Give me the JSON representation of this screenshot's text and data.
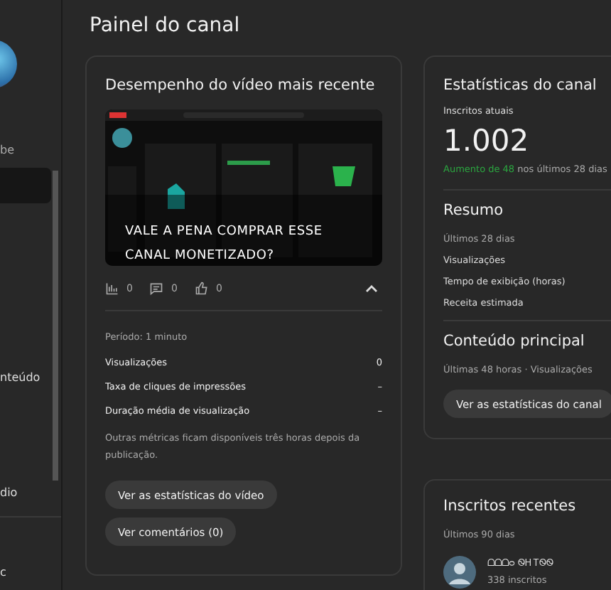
{
  "sidebar": {
    "items": [
      {
        "label": "be",
        "selected": false
      },
      {
        "selected": true
      },
      {
        "label": "nteúdo",
        "selected": false
      },
      {
        "label": "dio",
        "selected": false
      }
    ],
    "footer": "c"
  },
  "page_title": "Painel do canal",
  "video_card": {
    "title": "Desempenho do vídeo mais recente",
    "video_title": "VALE A PENA COMPRAR ESSE CANAL MONETIZADO?",
    "counts": [
      {
        "kind": "views",
        "value": "0"
      },
      {
        "kind": "comments",
        "value": "0"
      },
      {
        "kind": "likes",
        "value": "0"
      }
    ],
    "expanded": true,
    "period": "Período: 1 minuto",
    "metrics": [
      {
        "label": "Visualizações",
        "value": "0"
      },
      {
        "label": "Taxa de cliques de impressões",
        "value": "–"
      },
      {
        "label": "Duração média de visualização",
        "value": "–"
      }
    ],
    "note": "Outras métricas ficam disponíveis três horas depois da publicação.",
    "buttons": [
      "Ver as estatísticas do vídeo",
      "Ver comentários (0)"
    ]
  },
  "stats_card": {
    "title": "Estatísticas do canal",
    "subs_label": "Inscritos atuais",
    "subs_value": "1.002",
    "growth": "Aumento de 48",
    "growth_rest": " nos últimos 28 dias",
    "summary_title": "Resumo",
    "summary_sub": "Últimos 28 dias",
    "summary_rows": [
      "Visualizações",
      "Tempo de exibição (horas)",
      "Receita estimada"
    ],
    "top_title": "Conteúdo principal",
    "top_sub": "Últimas 48 horas · Visualizações",
    "button": "Ver as estatísticas do canal"
  },
  "recent_card": {
    "title": "Inscritos recentes",
    "sub": "Últimos 90 dias",
    "subscribers": [
      {
        "name": "ᗝᗝᗝᴑ ᏫᎻ ᎢᏫᏫ",
        "count": "338 inscritos"
      }
    ]
  }
}
